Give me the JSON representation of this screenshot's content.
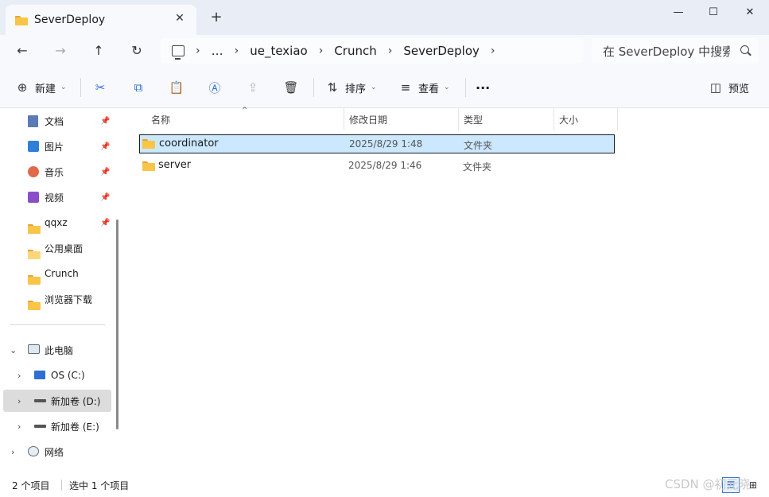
{
  "window": {
    "tab_title": "SeverDeploy",
    "tab_close": "✕",
    "new_tab": "+",
    "minimize": "—",
    "maximize": "☐",
    "close": "✕"
  },
  "nav": {
    "back": "←",
    "forward": "→",
    "up": "↑",
    "refresh": "↻",
    "breadcrumb": [
      "…",
      "ue_texiao",
      "Crunch",
      "SeverDeploy"
    ],
    "search_placeholder": "在 SeverDeploy 中搜索"
  },
  "toolbar": {
    "new_label": "新建",
    "sort_label": "排序",
    "view_label": "查看",
    "more": "···",
    "preview_label": "预览",
    "icons": [
      "cut-icon",
      "copy-icon",
      "paste-icon",
      "rename-icon",
      "share-icon",
      "delete-icon"
    ]
  },
  "sidebar": {
    "quick_access": [
      {
        "label": "文档",
        "icon": "documents-icon",
        "pinned": true
      },
      {
        "label": "图片",
        "icon": "pictures-icon",
        "pinned": true
      },
      {
        "label": "音乐",
        "icon": "music-icon",
        "pinned": true
      },
      {
        "label": "视频",
        "icon": "videos-icon",
        "pinned": true
      },
      {
        "label": "qqxz",
        "icon": "folder-icon",
        "pinned": true
      },
      {
        "label": "公用桌面",
        "icon": "folder-icon",
        "pinned": false
      },
      {
        "label": "Crunch",
        "icon": "folder-icon",
        "pinned": false
      },
      {
        "label": "浏览器下载",
        "icon": "folder-icon",
        "pinned": false
      }
    ],
    "this_pc": "此电脑",
    "drives": [
      "OS (C:)",
      "新加卷 (D:)",
      "新加卷 (E:)"
    ],
    "network": "网络",
    "pin_glyph": "📌"
  },
  "columns": {
    "name": "名称",
    "modified": "修改日期",
    "type": "类型",
    "size": "大小"
  },
  "files": [
    {
      "name": "coordinator",
      "modified": "2025/8/29 1:48",
      "type": "文件夹",
      "selected": true
    },
    {
      "name": "server",
      "modified": "2025/8/29 1:46",
      "type": "文件夹",
      "selected": false
    }
  ],
  "status": {
    "count": "2 个项目",
    "selection": "选中 1 个项目"
  },
  "watermark": "CSDN @初元晓"
}
